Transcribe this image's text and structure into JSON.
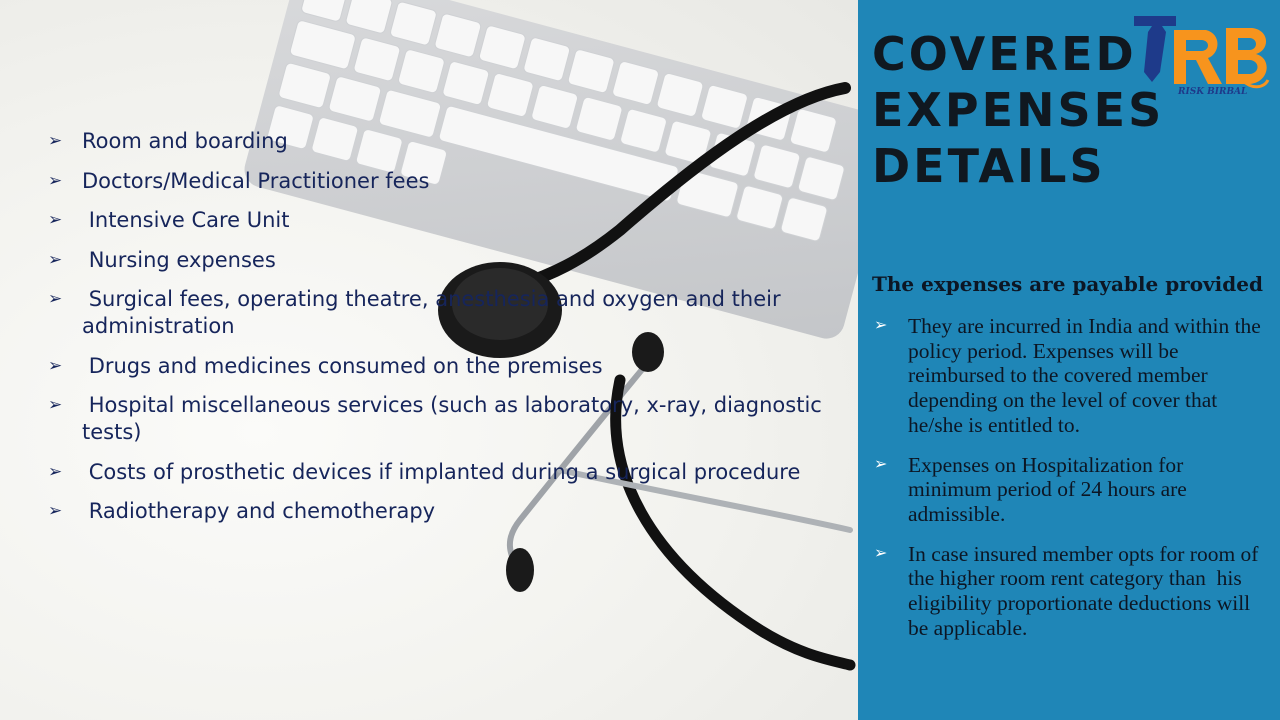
{
  "left_list": {
    "bullet_icon": "arrow-bullet-icon",
    "items": [
      "Room and boarding",
      "Doctors/Medical Practitioner fees",
      " Intensive Care Unit",
      " Nursing expenses",
      " Surgical fees, operating theatre, anesthesia and oxygen and their administration",
      " Drugs and medicines consumed on the premises",
      " Hospital miscellaneous services (such as laboratory, x-ray, diagnostic tests)",
      " Costs of prosthetic devices if implanted during a surgical procedure",
      " Radiotherapy and chemotherapy"
    ]
  },
  "panel": {
    "title_lines": [
      "COVERED",
      "EXPENSES",
      "DETAILS"
    ],
    "logo": {
      "text": "RISK BIRBAL",
      "colors": {
        "blue": "#1e3a8a",
        "orange": "#f7941d"
      }
    },
    "subheading": "The expenses are payable provided",
    "items": [
      "They are incurred in India and within the policy period. Expenses will be reimbursed to the covered member depending on the level of cover that he/she is entitled to.",
      "Expenses on Hospitalization for minimum period of 24 hours are admissible.",
      "In case insured member opts for room of the higher room rent category than  his eligibility proportionate deductions will be applicable."
    ]
  },
  "colors": {
    "panel_bg": "#1f86b7",
    "left_text": "#16255b",
    "right_text": "#0c1624"
  }
}
